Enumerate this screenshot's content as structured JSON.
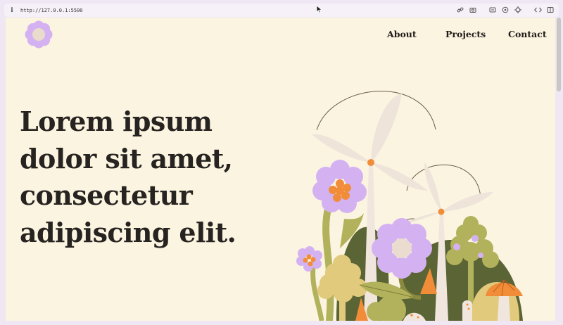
{
  "browser": {
    "url": "http://127.0.0.1:5500",
    "icons": [
      "info-icon",
      "link-icon",
      "camera-icon",
      "caption-icon",
      "extension-icon",
      "crosshair-icon",
      "devtools-icon",
      "sidebar-icon"
    ]
  },
  "site": {
    "logo": "flower-logo",
    "nav": {
      "about": "About",
      "projects": "Projects",
      "contact": "Contact"
    },
    "hero": {
      "title": "Lorem ipsum dolor sit amet, consectetur adipiscing elit."
    },
    "illustration": "windmills-and-flowers-illustration"
  },
  "colors": {
    "background": "#fbf4e1",
    "text": "#262320",
    "lavender": "#d4b2f2",
    "orange": "#f18d39",
    "olive": "#b3b25c",
    "dark_green": "#5b6434",
    "sand": "#e2ca7d"
  }
}
